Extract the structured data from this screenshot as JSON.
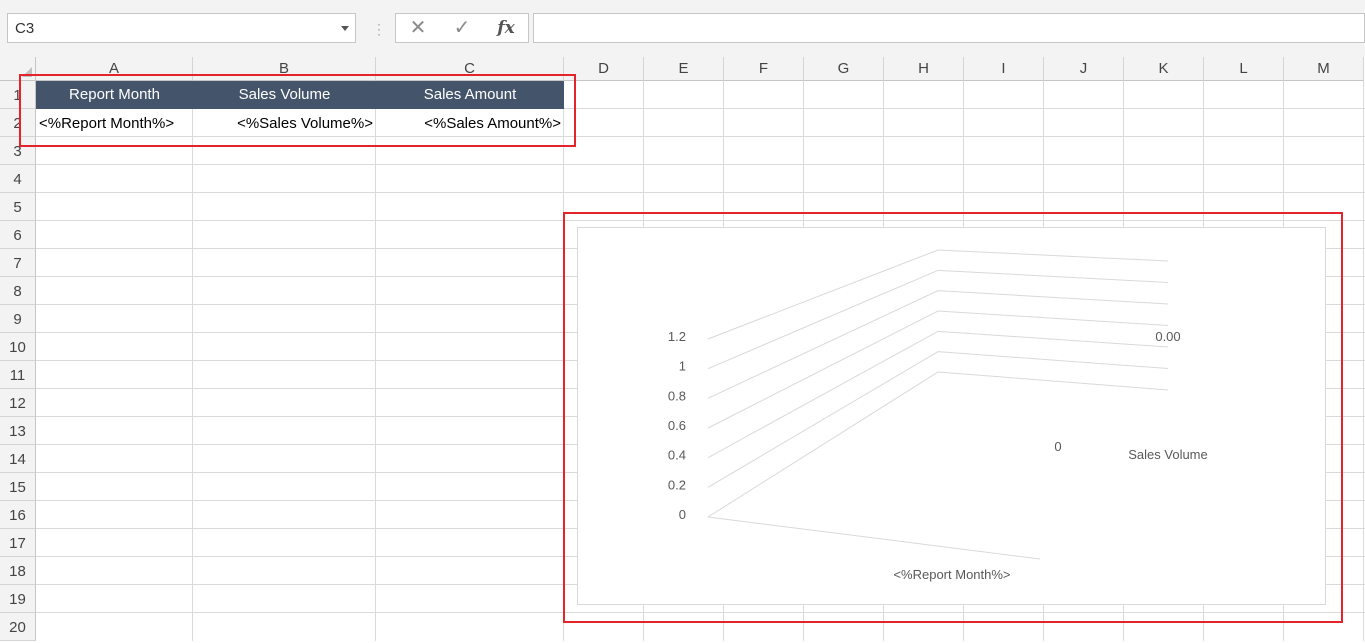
{
  "formula_bar": {
    "name_box": "C3",
    "cancel_icon": "✕",
    "enter_icon": "✓",
    "fx_label": "fx",
    "formula": ""
  },
  "columns": [
    "A",
    "B",
    "C",
    "D",
    "E",
    "F",
    "G",
    "H",
    "I",
    "J",
    "K",
    "L",
    "M"
  ],
  "rows": [
    "1",
    "2",
    "3",
    "4",
    "5",
    "6",
    "7",
    "8",
    "9",
    "10",
    "11",
    "12",
    "13",
    "14",
    "15",
    "16",
    "17",
    "18",
    "19",
    "20"
  ],
  "table": {
    "headers": [
      "Report Month",
      "Sales Volume",
      "Sales Amount"
    ],
    "row": [
      "<%Report Month%>",
      "<%Sales Volume%>",
      "<%Sales Amount%>"
    ]
  },
  "chart_data": {
    "type": "bar",
    "categories": [
      "<%Report Month%>"
    ],
    "series": [
      {
        "name": "Sales Volume",
        "values": [
          0
        ],
        "data_labels": [
          "0"
        ]
      }
    ],
    "secondary_data_label": "0.00",
    "y_ticks": [
      "0",
      "0.2",
      "0.4",
      "0.6",
      "0.8",
      "1",
      "1.2"
    ],
    "ylim": [
      0,
      1.2
    ],
    "xlabel": "",
    "ylabel": "",
    "depth_label": "Sales Volume",
    "style": "3d",
    "grid": true
  },
  "colors": {
    "header_fill": "#44546a",
    "highlight": "#e4242b"
  }
}
